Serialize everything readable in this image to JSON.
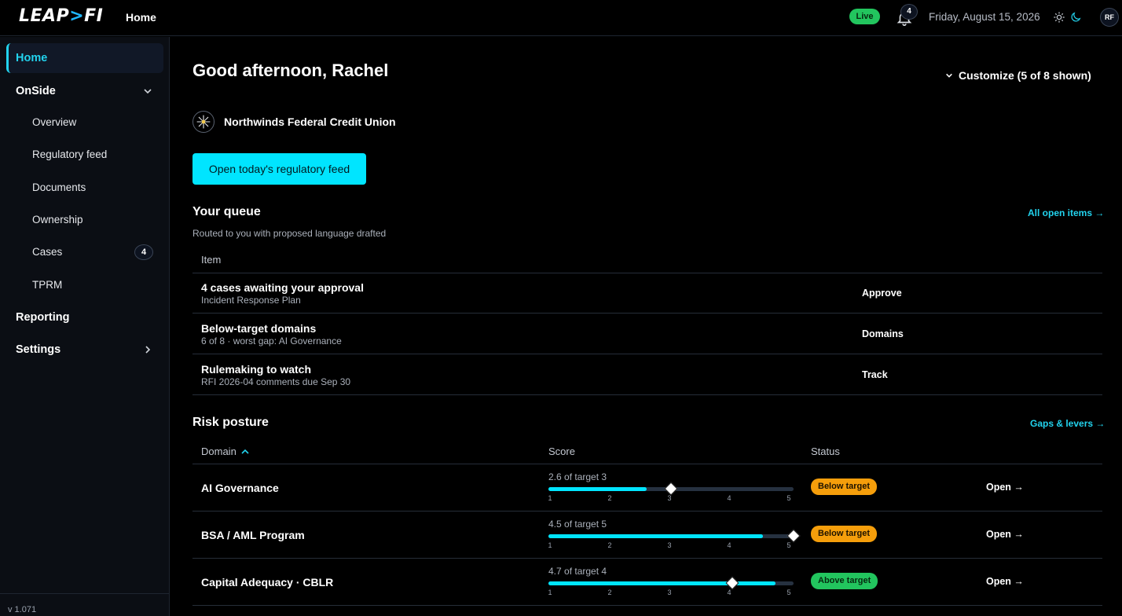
{
  "app": {
    "logo_text": "LEAP",
    "logo_suffix": "FI",
    "logo_chevron": ">"
  },
  "topbar": {
    "home_label": "Home",
    "live_label": "Live",
    "notifications_count": "4",
    "date": "Friday, August 15, 2026",
    "avatar_initials": "RF"
  },
  "sidebar": {
    "home": "Home",
    "onside": "OnSide",
    "subitems": [
      "Overview",
      "Regulatory feed",
      "Documents",
      "Ownership",
      "Cases",
      "TPRM"
    ],
    "cases_badge": "4",
    "reporting": "Reporting",
    "settings": "Settings",
    "version": "v 1.071"
  },
  "main": {
    "greeting": "Good afternoon, Rachel",
    "customize": "Customize (5 of 8 shown)",
    "org_name": "Northwinds Federal Credit Union",
    "cta": "Open today's regulatory feed",
    "queue": {
      "title": "Your queue",
      "link": "All open items →",
      "subtitle": "Routed to you with proposed language drafted",
      "col_item": "Item",
      "rows": [
        {
          "title": "4 cases awaiting your approval",
          "sub": "Incident Response Plan",
          "action": "Approve"
        },
        {
          "title": "Below-target domains",
          "sub": "6 of 8 · worst gap: AI Governance",
          "action": "Domains"
        },
        {
          "title": "Rulemaking to watch",
          "sub": "RFI 2026-04 comments due Sep 30",
          "action": "Track"
        }
      ]
    },
    "risk": {
      "title": "Risk posture",
      "link": "Gaps & levers →",
      "col_domain": "Domain",
      "col_score": "Score",
      "col_status": "Status",
      "ticks": [
        "1",
        "2",
        "3",
        "4",
        "5"
      ],
      "rows": [
        {
          "domain": "AI Governance",
          "score_label": "2.6 of target 3",
          "score": 2.6,
          "target": 3,
          "status": "Below target",
          "status_kind": "below",
          "open": "Open →"
        },
        {
          "domain": "BSA / AML Program",
          "score_label": "4.5 of target 5",
          "score": 4.5,
          "target": 5,
          "status": "Below target",
          "status_kind": "below",
          "open": "Open →"
        },
        {
          "domain": "Capital Adequacy · CBLR",
          "score_label": "4.7 of target 4",
          "score": 4.7,
          "target": 4,
          "status": "Above target",
          "status_kind": "above",
          "open": "Open →"
        }
      ]
    }
  },
  "colors": {
    "accent": "#00e5ff",
    "live": "#22c55e",
    "below": "#f59e0b",
    "above": "#22c55e"
  }
}
